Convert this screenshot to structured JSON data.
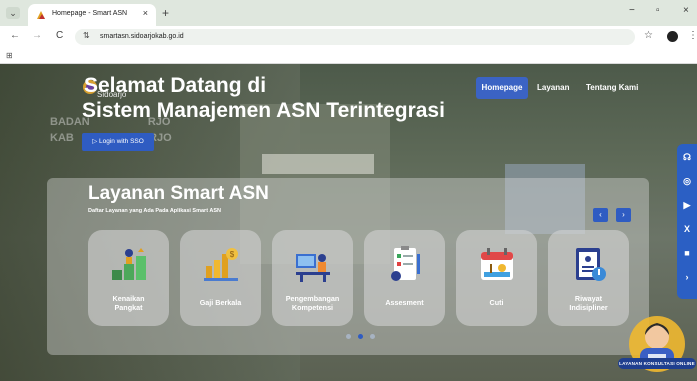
{
  "browser": {
    "tab_title": "Homepage - Smart ASN",
    "tab_close": "×",
    "new_tab": "+",
    "window_controls": {
      "minimize": "−",
      "restore": "▫",
      "close": "×"
    },
    "back": "←",
    "forward": "→",
    "reload": "C",
    "url": "smartasn.sidoarjokab.go.id",
    "bookmark_star": "☆",
    "menu": "⋮",
    "tab_menu": "⌄",
    "apps": "⊞"
  },
  "header": {
    "logo_text": "Sidoarjo",
    "hero_line1": "Selamat Datang di",
    "hero_line2": "Sistem Manajemen ASN Terintegrasi",
    "nav": [
      {
        "label": "Homepage",
        "active": true
      },
      {
        "label": "Layanan",
        "active": false
      },
      {
        "label": "Tentang Kami",
        "active": false
      }
    ],
    "login_button": "▷  Login with SSO"
  },
  "background_text": {
    "line1": "BADAN",
    "line2": "KAB",
    "line3": "ARJO",
    "line4": "RJO"
  },
  "services": {
    "title": "Layanan Smart ASN",
    "subtitle": "Daftar Layanan yang Ada Pada Aplikasi Smart ASN",
    "prev": "‹",
    "next": "›",
    "cards": [
      {
        "label_line1": "Kenaikan",
        "label_line2": "Pangkat",
        "icon": "promotion-icon"
      },
      {
        "label_line1": "Gaji Berkala",
        "label_line2": "",
        "icon": "salary-icon"
      },
      {
        "label_line1": "Pengembangan",
        "label_line2": "Kompetensi",
        "icon": "competency-icon"
      },
      {
        "label_line1": "Assesment",
        "label_line2": "",
        "icon": "assessment-icon"
      },
      {
        "label_line1": "Cuti",
        "label_line2": "",
        "icon": "leave-calendar-icon"
      },
      {
        "label_line1": "Riwayat",
        "label_line2": "Indisipliner",
        "icon": "discipline-record-icon"
      }
    ],
    "carousel_dots": 3,
    "active_dot": 1
  },
  "social": [
    "headset-icon",
    "instagram-icon",
    "youtube-icon",
    "x-icon",
    "video-icon",
    "chevron-right-icon"
  ],
  "chat": {
    "label": "LAYANAN KONSULTASI ONLINE"
  },
  "colors": {
    "accent": "#2f5cc2",
    "panel": "#e1e1e1",
    "text": "#ffffff"
  }
}
